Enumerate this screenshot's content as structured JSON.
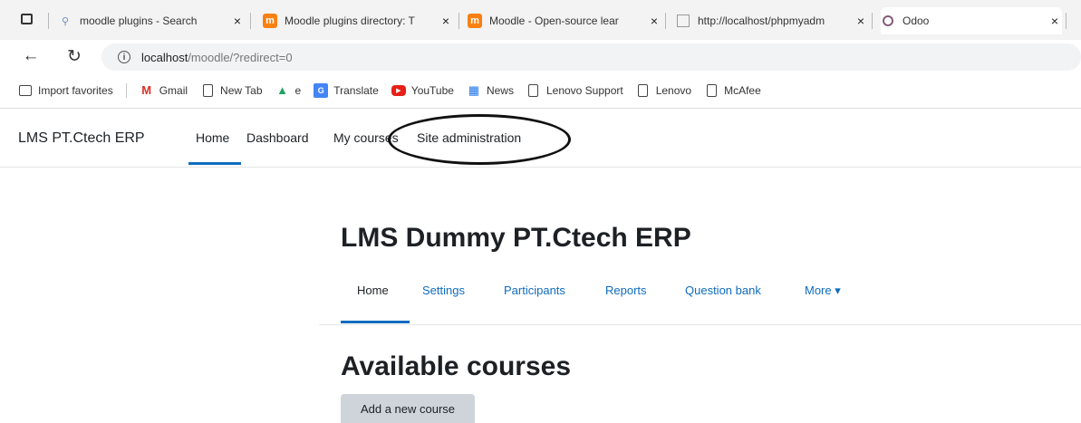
{
  "tabs": [
    {
      "title": "moodle plugins - Search",
      "favicon": "search-icon"
    },
    {
      "title": "Moodle plugins directory: T",
      "favicon": "moodle-icon"
    },
    {
      "title": "Moodle - Open-source lear",
      "favicon": "moodle-icon"
    },
    {
      "title": "http://localhost/phpmyadm",
      "favicon": "page-icon"
    },
    {
      "title": "Odoo",
      "favicon": "odoo-icon"
    }
  ],
  "tab_close_glyph": "×",
  "address": {
    "host": "localhost",
    "path": "/moodle/?redirect=0"
  },
  "bookmarks": [
    {
      "label": "Import favorites",
      "icon": "import-icon"
    },
    {
      "label": "Gmail",
      "icon": "gmail-icon"
    },
    {
      "label": "New Tab",
      "icon": "page-icon"
    },
    {
      "label": "e",
      "icon": "drive-icon"
    },
    {
      "label": "Translate",
      "icon": "translate-icon"
    },
    {
      "label": "YouTube",
      "icon": "youtube-icon"
    },
    {
      "label": "News",
      "icon": "news-icon"
    },
    {
      "label": "Lenovo Support",
      "icon": "page-icon"
    },
    {
      "label": "Lenovo",
      "icon": "page-icon"
    },
    {
      "label": "McAfee",
      "icon": "page-icon"
    }
  ],
  "site": {
    "name": "LMS PT.Ctech ERP",
    "nav": {
      "home": "Home",
      "dashboard": "Dashboard",
      "mycourses": "My courses",
      "siteadmin": "Site administration"
    }
  },
  "course": {
    "title": "LMS Dummy PT.Ctech ERP",
    "secnav": {
      "home": "Home",
      "settings": "Settings",
      "participants": "Participants",
      "reports": "Reports",
      "questionbank": "Question bank",
      "more": "More ▾"
    }
  },
  "available": {
    "heading": "Available courses",
    "add_button": "Add a new course"
  },
  "colors": {
    "link": "#0f6cbf",
    "text": "#1d2125",
    "button": "#ced4da"
  }
}
